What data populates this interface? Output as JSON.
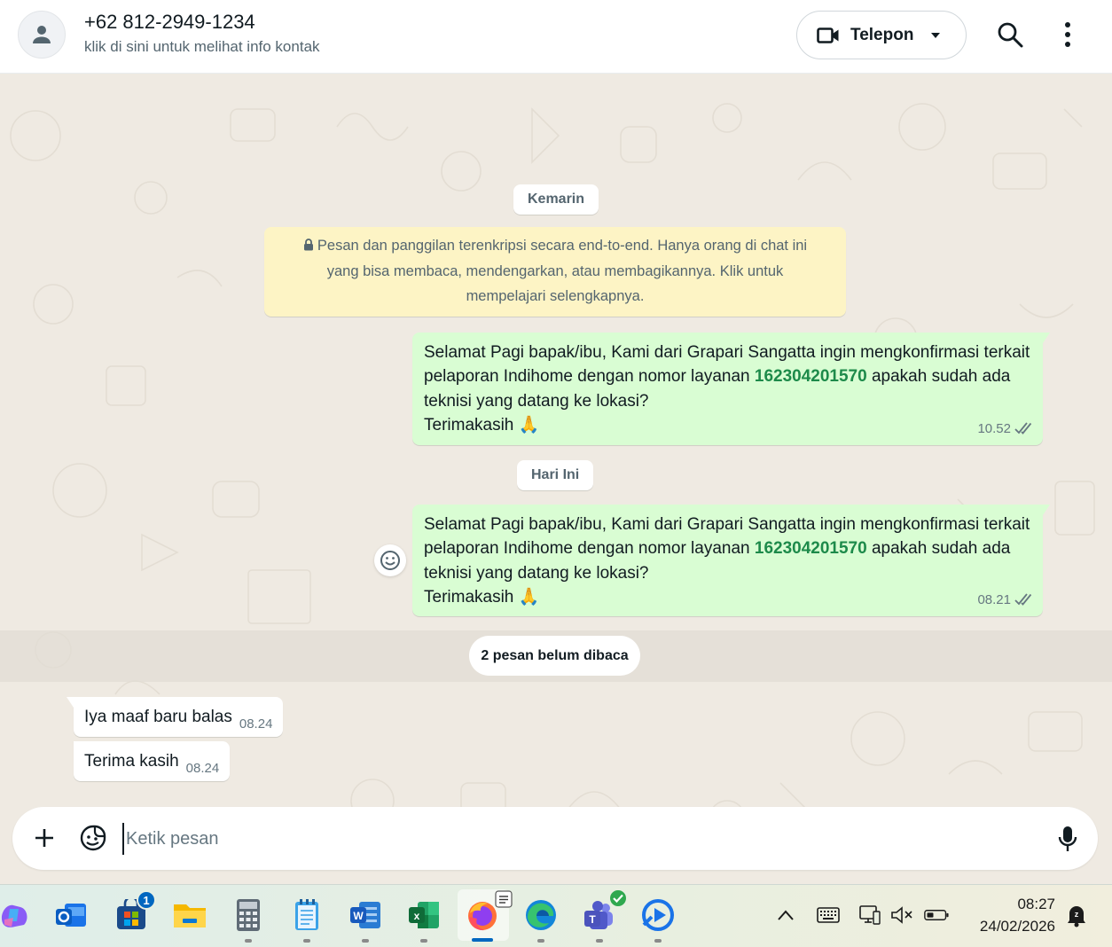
{
  "header": {
    "contact_name": "+62 812-2949-1234",
    "contact_subtitle": "klik di sini untuk melihat info kontak",
    "call_label": "Telepon"
  },
  "chat": {
    "date_yesterday": "Kemarin",
    "encryption_notice": "Pesan dan panggilan terenkripsi secara end-to-end. Hanya orang di chat ini yang bisa membaca, mendengarkan, atau membagikannya. Klik untuk mempelajari selengkapnya.",
    "messages_out": [
      {
        "text_before": "Selamat Pagi bapak/ibu, Kami dari Grapari Sangatta ingin mengkonfirmasi terkait pelaporan Indihome dengan nomor layanan ",
        "number": "162304201570",
        "text_after": " apakah sudah ada teknisi yang datang ke lokasi?",
        "closing": "Terimakasih 🙏",
        "time": "10.52"
      },
      {
        "text_before": "Selamat Pagi bapak/ibu, Kami dari Grapari Sangatta ingin mengkonfirmasi terkait pelaporan Indihome dengan nomor layanan ",
        "number": "162304201570",
        "text_after": " apakah sudah ada teknisi yang datang ke lokasi?",
        "closing": "Terimakasih 🙏",
        "time": "08.21"
      }
    ],
    "date_today": "Hari Ini",
    "unread_label": "2 pesan belum dibaca",
    "messages_in": [
      {
        "text": "Iya maaf baru balas",
        "time": "08.24"
      },
      {
        "text": "Terima kasih",
        "time": "08.24"
      }
    ]
  },
  "composer": {
    "placeholder": "Ketik pesan"
  },
  "taskbar": {
    "apps": [
      "copilot-icon",
      "outlook-icon",
      "store-icon",
      "file-explorer-icon",
      "calculator-icon",
      "notepad-icon",
      "word-icon",
      "excel-icon",
      "firefox-icon",
      "edge-icon",
      "teams-icon",
      "media-player-icon"
    ],
    "store_badge": "1",
    "time": "08:27",
    "date": "24/02/2026"
  },
  "colors": {
    "outgoing_bubble": "#d9fdd3",
    "incoming_bubble": "#ffffff",
    "wallpaper": "#efeae2",
    "encryption_notice": "#fdf4c5",
    "link_number": "#1d8a4a"
  }
}
